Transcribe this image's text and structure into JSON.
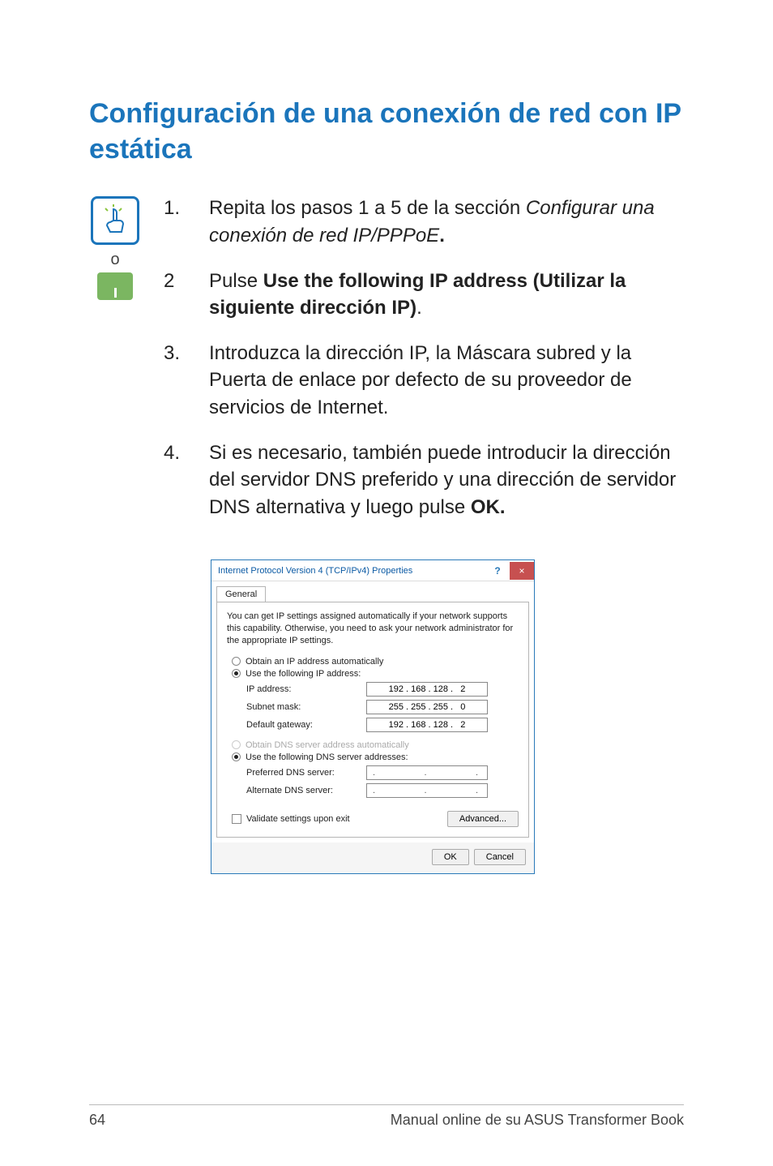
{
  "heading": "Configuración de una conexión de red con IP estática",
  "or_label": "o",
  "steps": {
    "s1": {
      "num": "1.",
      "pre": "Repita los pasos 1 a 5 de la sección ",
      "italic": "Configurar una conexión de red IP/PPPoE",
      "post": "."
    },
    "s2": {
      "num": "2",
      "pre": "Pulse ",
      "bold": "Use the following IP address (Utilizar la siguiente dirección IP)",
      "post": "."
    },
    "s3": {
      "num": "3.",
      "text": "Introduzca la dirección IP, la Máscara subred y la Puerta de enlace por defecto de su proveedor de servicios de Internet."
    },
    "s4": {
      "num": "4.",
      "pre": "Si es necesario, también puede introducir la dirección del servidor DNS preferido y una dirección de servidor DNS alternativa y luego pulse ",
      "bold": "OK.",
      "post": ""
    }
  },
  "dialog": {
    "title": "Internet Protocol Version 4 (TCP/IPv4) Properties",
    "help": "?",
    "close": "×",
    "tab": "General",
    "desc": "You can get IP settings assigned automatically if your network supports this capability. Otherwise, you need to ask your network administrator for the appropriate IP settings.",
    "radio_auto_ip": "Obtain an IP address automatically",
    "radio_use_ip": "Use the following IP address:",
    "ip_label": "IP address:",
    "ip_value": "192 . 168 . 128 .   2",
    "subnet_label": "Subnet mask:",
    "subnet_value": "255 . 255 . 255 .   0",
    "gateway_label": "Default gateway:",
    "gateway_value": "192 . 168 . 128 .   2",
    "radio_auto_dns": "Obtain DNS server address automatically",
    "radio_use_dns": "Use the following DNS server addresses:",
    "pref_dns_label": "Preferred DNS server:",
    "alt_dns_label": "Alternate DNS server:",
    "dots": ".        .        .",
    "validate": "Validate settings upon exit",
    "advanced": "Advanced...",
    "ok": "OK",
    "cancel": "Cancel"
  },
  "footer": {
    "page": "64",
    "text": "Manual online de su ASUS Transformer Book"
  }
}
